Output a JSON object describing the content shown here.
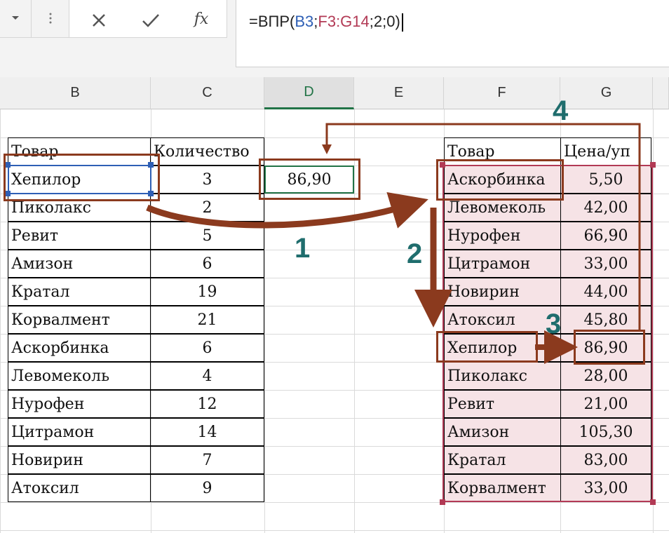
{
  "formula_bar": {
    "name_box_dropdown_icon": "chevron-down-icon",
    "cancel_icon": "close-icon",
    "enter_icon": "check-icon",
    "function_icon": "fx-icon",
    "fx_label": "fx",
    "formula_prefix": "=ВПР(",
    "formula_arg1": "B3",
    "formula_sep1": ";",
    "formula_arg2": "F3:G14",
    "formula_rest": ";2;0)"
  },
  "columns": [
    "B",
    "C",
    "D",
    "E",
    "F",
    "G"
  ],
  "left_table": {
    "header_product": "Товар",
    "header_qty": "Количество",
    "rows": [
      {
        "product": "Хепилор",
        "qty": "3"
      },
      {
        "product": "Пиколакс",
        "qty": "2"
      },
      {
        "product": "Ревит",
        "qty": "5"
      },
      {
        "product": "Амизон",
        "qty": "6"
      },
      {
        "product": "Кратал",
        "qty": "19"
      },
      {
        "product": "Корвалмент",
        "qty": "21"
      },
      {
        "product": "Аскорбинка",
        "qty": "6"
      },
      {
        "product": "Левомеколь",
        "qty": "4"
      },
      {
        "product": "Нурофен",
        "qty": "12"
      },
      {
        "product": "Цитрамон",
        "qty": "14"
      },
      {
        "product": "Новирин",
        "qty": "7"
      },
      {
        "product": "Атоксил",
        "qty": "9"
      }
    ]
  },
  "result_cell": "86,90",
  "right_table": {
    "header_product": "Товар",
    "header_price": "Цена/уп",
    "rows": [
      {
        "product": "Аскорбинка",
        "price": "5,50"
      },
      {
        "product": "Левомеколь",
        "price": "42,00"
      },
      {
        "product": "Нурофен",
        "price": "66,90"
      },
      {
        "product": "Цитрамон",
        "price": "33,00"
      },
      {
        "product": "Новирин",
        "price": "44,00"
      },
      {
        "product": "Атоксил",
        "price": "45,80"
      },
      {
        "product": "Хепилор",
        "price": "86,90"
      },
      {
        "product": "Пиколакс",
        "price": "28,00"
      },
      {
        "product": "Ревит",
        "price": "21,00"
      },
      {
        "product": "Амизон",
        "price": "105,30"
      },
      {
        "product": "Кратал",
        "price": "83,00"
      },
      {
        "product": "Корвалмент",
        "price": "33,00"
      }
    ]
  },
  "step_labels": [
    "1",
    "2",
    "3",
    "4"
  ],
  "colors": {
    "highlight_box": "#8b3a1e",
    "arrow": "#8b3a1e",
    "step_number": "#1f6d6d",
    "lookup_range": "#b23a55",
    "lookup_fill": "#f6e3e6",
    "selection": "#217346",
    "ref_b3": "#2e5fb5"
  }
}
